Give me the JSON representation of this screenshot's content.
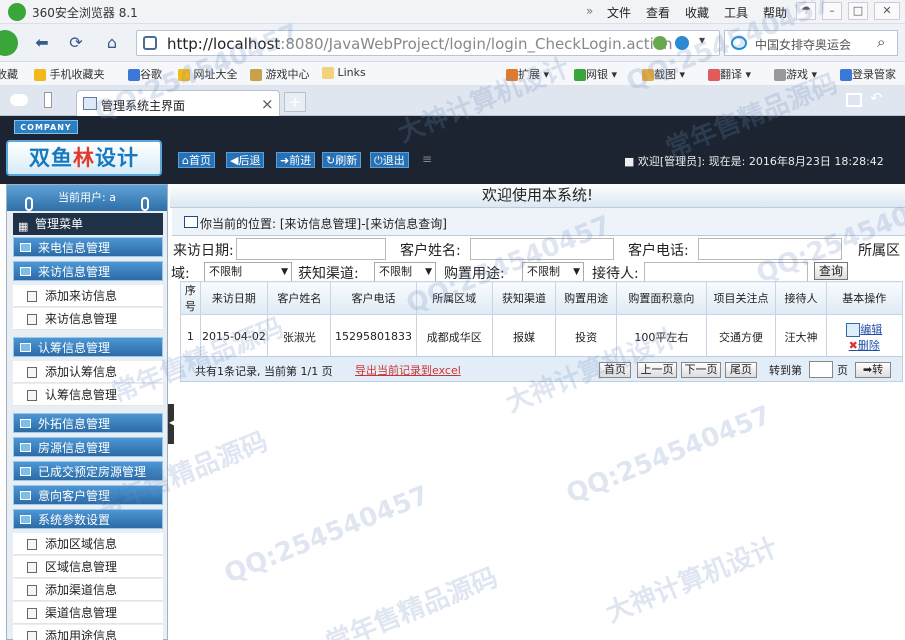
{
  "browser": {
    "title": "360安全浏览器 8.1",
    "menus": [
      "文件",
      "查看",
      "收藏",
      "工具",
      "帮助"
    ],
    "url_host": "http://localhost",
    "url_rest": ":8080/JavaWebProject/login/login_CheckLogin.action",
    "search_text": "中国女排夺奥运会",
    "favorites": [
      "收藏",
      "手机收藏夹",
      "谷歌",
      "网址大全",
      "游戏中心",
      "Links"
    ],
    "right_tools": [
      "扩展",
      "网银",
      "截图",
      "翻译",
      "游戏",
      "登录管家"
    ],
    "tab_title": "管理系统主界面",
    "tab_close": "×",
    "new_tab": "+"
  },
  "header": {
    "company_badge": "COMPANY",
    "logo_text_a": "双鱼",
    "logo_text_b": "林",
    "logo_text_c": "设计",
    "buttons": [
      "首页",
      "后退",
      "前进",
      "刷新",
      "退出"
    ],
    "info": "■ 欢迎[管理员]:  现在是: 2016年8月23日 18:28:42"
  },
  "sidebar": {
    "current_user": "当前用户: a",
    "main_menu": "管理菜单",
    "items": [
      {
        "type": "group",
        "label": "来电信息管理"
      },
      {
        "type": "group",
        "label": "来访信息管理"
      },
      {
        "type": "sub",
        "label": "添加来访信息"
      },
      {
        "type": "sub",
        "label": "来访信息管理"
      },
      {
        "type": "group",
        "label": "认筹信息管理"
      },
      {
        "type": "sub",
        "label": "添加认筹信息"
      },
      {
        "type": "sub",
        "label": "认筹信息管理"
      },
      {
        "type": "group",
        "label": "外拓信息管理"
      },
      {
        "type": "group",
        "label": "房源信息管理"
      },
      {
        "type": "group",
        "label": "已成交预定房源管理"
      },
      {
        "type": "group",
        "label": "意向客户管理"
      },
      {
        "type": "group",
        "label": "系统参数设置"
      },
      {
        "type": "sub",
        "label": "添加区域信息"
      },
      {
        "type": "sub",
        "label": "区域信息管理"
      },
      {
        "type": "sub",
        "label": "添加渠道信息"
      },
      {
        "type": "sub",
        "label": "渠道信息管理"
      },
      {
        "type": "sub",
        "label": "添加用途信息"
      }
    ]
  },
  "content": {
    "welcome": "欢迎使用本系统!",
    "position": "你当前的位置: [来访信息管理]-[来访信息查询]",
    "filters": {
      "visit_date": "来访日期:",
      "customer_name": "客户姓名:",
      "customer_phone": "客户电话:",
      "area_a": "所属区",
      "area_b": "域:",
      "area_value": "不限制",
      "channel": "获知渠道:",
      "channel_value": "不限制",
      "purpose": "购置用途:",
      "purpose_value": "不限制",
      "receiver": "接待人:",
      "query_button": "查询"
    },
    "table": {
      "headers": [
        "序号",
        "来访日期",
        "客户姓名",
        "客户电话",
        "所属区域",
        "获知渠道",
        "购置用途",
        "购置面积意向",
        "项目关注点",
        "接待人",
        "基本操作"
      ],
      "rows": [
        [
          "1",
          "2015-04-02",
          "张淑光",
          "15295801833",
          "成都成华区",
          "报媒",
          "投资",
          "100平左右",
          "交通方便",
          "汪大神"
        ]
      ],
      "edit": "编辑",
      "delete": "删除"
    },
    "pager": {
      "info": "共有1条记录, 当前第 1/1 页",
      "export": "导出当前记录到excel",
      "first": "首页",
      "prev": "上一页",
      "next": "下一页",
      "last": "尾页",
      "goto": "转到第",
      "page_unit": "页",
      "go": "➡转"
    }
  },
  "watermarks": [
    "QQ:254540457",
    "大神计算机设计",
    "常年售精品源码"
  ]
}
